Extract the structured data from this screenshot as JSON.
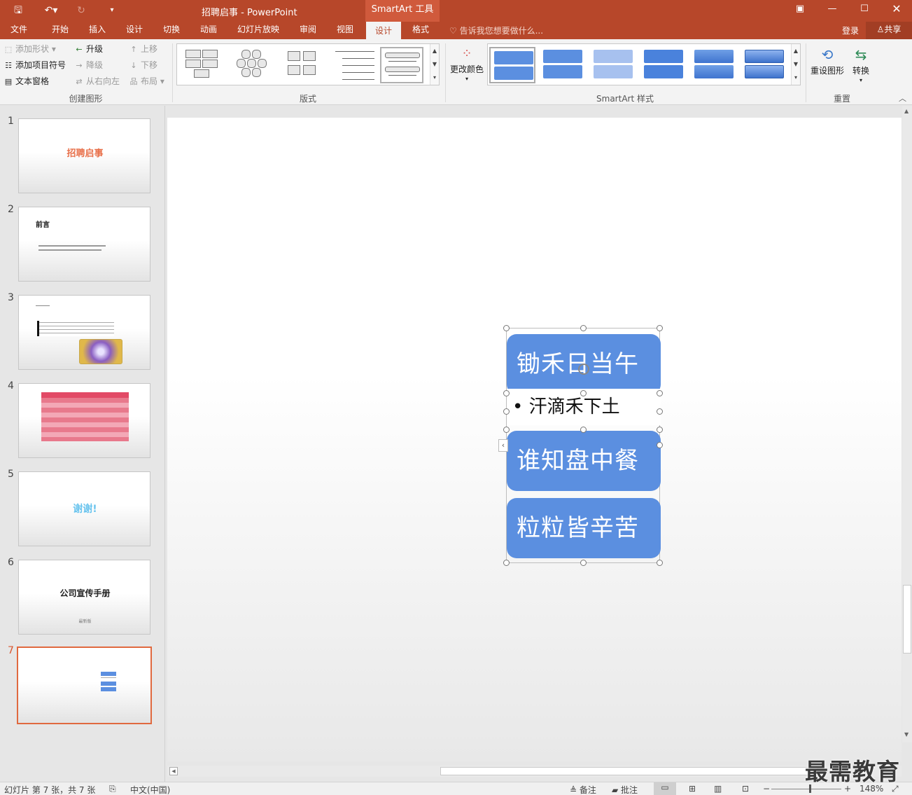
{
  "titlebar": {
    "doc_title": "招聘启事 - PowerPoint",
    "context_tools": "SmartArt 工具"
  },
  "tabs": [
    {
      "label": "文件"
    },
    {
      "label": "开始"
    },
    {
      "label": "插入"
    },
    {
      "label": "设计"
    },
    {
      "label": "切换"
    },
    {
      "label": "动画"
    },
    {
      "label": "幻灯片放映"
    },
    {
      "label": "审阅"
    },
    {
      "label": "视图"
    },
    {
      "label": "设计"
    },
    {
      "label": "格式"
    }
  ],
  "tell_me": "告诉我您想要做什么...",
  "account": {
    "login": "登录",
    "share": "共享"
  },
  "ribbon": {
    "create": {
      "add_shape": "添加形状",
      "add_bullet": "添加项目符号",
      "text_pane": "文本窗格",
      "promote": "升级",
      "demote": "降级",
      "rtl": "从右向左",
      "move_up": "上移",
      "move_down": "下移",
      "layout": "布局",
      "group_label": "创建图形"
    },
    "layouts": {
      "group_label": "版式"
    },
    "styles": {
      "change_colors": "更改颜色",
      "group_label": "SmartArt 样式"
    },
    "reset": {
      "reset_graphic": "重设图形",
      "convert": "转换",
      "group_label": "重置"
    }
  },
  "slides": [
    {
      "number": "1",
      "title": "招聘启事"
    },
    {
      "number": "2",
      "title": "前言"
    },
    {
      "number": "3",
      "title": ""
    },
    {
      "number": "4",
      "title": ""
    },
    {
      "number": "5",
      "title": "谢谢!"
    },
    {
      "number": "6",
      "title": "公司宣传手册",
      "subtitle": "最新版"
    },
    {
      "number": "7",
      "title": ""
    }
  ],
  "smartart": {
    "item1": "锄禾日当午",
    "bullet": "汗滴禾下土",
    "item2": "谁知盘中餐",
    "item3": "粒粒皆辛苦"
  },
  "status": {
    "slide_info": "幻灯片 第 7 张，共 7 张",
    "language": "中文(中国)",
    "notes": "备注",
    "comments": "批注",
    "zoom": "148%"
  },
  "watermark": "最需教育",
  "colors": {
    "accent": "#b7472a",
    "smartart_fill": "#5b8fe0",
    "selected_slide": "#e0693f"
  }
}
